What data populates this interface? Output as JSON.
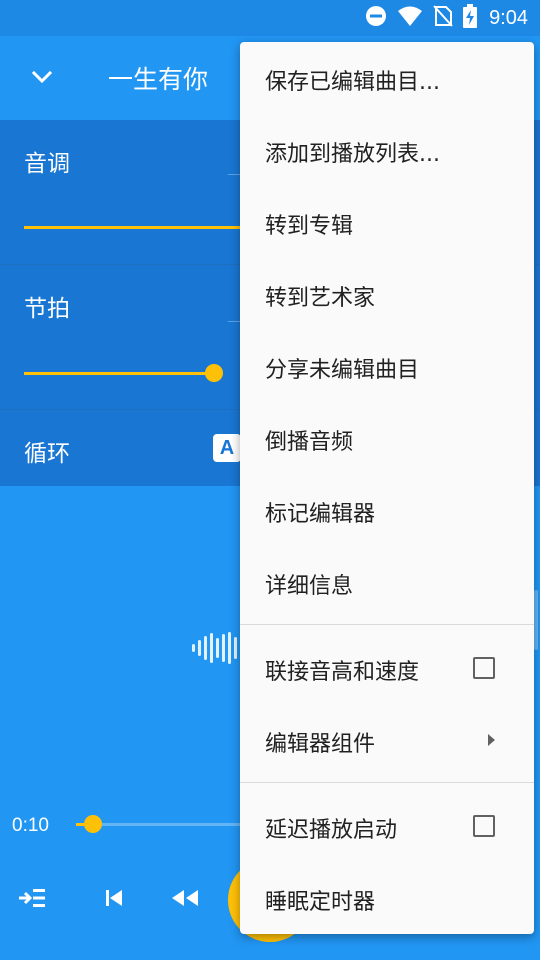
{
  "status_bar": {
    "time": "9:04",
    "icons": [
      "do-not-disturb-icon",
      "wifi-icon",
      "no-sim-icon",
      "battery-charging-icon"
    ]
  },
  "app_bar": {
    "collapse_icon": "chevron-down-icon",
    "title": "一生有你"
  },
  "effects": {
    "pitch": {
      "label": "音调",
      "level": 1.0
    },
    "tempo": {
      "label": "节拍",
      "level": 0.9
    },
    "loop": {
      "label": "循环",
      "mode_badge": "A"
    }
  },
  "player": {
    "current_time": "0:10",
    "progress": 0.07,
    "controls": [
      "queue-icon",
      "skip-previous-icon",
      "rewind-icon",
      "play-icon"
    ]
  },
  "menu": {
    "items": [
      {
        "label": "保存已编辑曲目..."
      },
      {
        "label": "添加到播放列表..."
      },
      {
        "label": "转到专辑"
      },
      {
        "label": "转到艺术家"
      },
      {
        "label": "分享未编辑曲目"
      },
      {
        "label": "倒播音频"
      },
      {
        "label": "标记编辑器"
      },
      {
        "label": "详细信息"
      },
      {
        "label": "联接音高和速度",
        "checkbox": false
      },
      {
        "label": "编辑器组件",
        "submenu": true
      },
      {
        "label": "延迟播放启动",
        "checkbox": false
      },
      {
        "label": "睡眠定时器"
      }
    ]
  },
  "colors": {
    "primary": "#2196F3",
    "panel": "#1976D2",
    "accent": "#FFC107",
    "menu_background": "#FAFAFA"
  }
}
